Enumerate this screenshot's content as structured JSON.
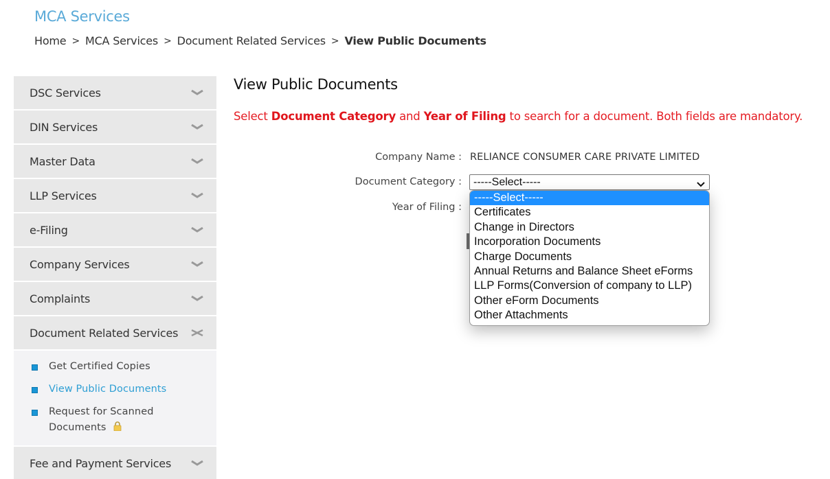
{
  "header": {
    "site_title": "MCA Services",
    "breadcrumb": [
      {
        "label": "Home"
      },
      {
        "label": "MCA Services"
      },
      {
        "label": "Document Related Services"
      },
      {
        "label": "View Public Documents"
      }
    ],
    "separator": ">"
  },
  "sidebar": {
    "items": [
      {
        "label": "DSC Services",
        "icon": "chevron-down-icon"
      },
      {
        "label": "DIN Services",
        "icon": "chevron-down-icon"
      },
      {
        "label": "Master Data",
        "icon": "chevron-down-icon"
      },
      {
        "label": "LLP Services",
        "icon": "chevron-down-icon"
      },
      {
        "label": "e-Filing",
        "icon": "chevron-down-icon"
      },
      {
        "label": "Company Services",
        "icon": "chevron-down-icon"
      },
      {
        "label": "Complaints",
        "icon": "chevron-down-icon"
      },
      {
        "label": "Document Related Services",
        "icon": "collapse-icon",
        "expanded": true
      },
      {
        "label": "Fee and Payment Services",
        "icon": "chevron-down-icon"
      }
    ],
    "sub_items": [
      {
        "label": "Get Certified Copies",
        "active": false
      },
      {
        "label": "View Public Documents",
        "active": true
      },
      {
        "label": "Request for Scanned Documents",
        "active": false,
        "locked": true,
        "icon": "lock-icon"
      }
    ]
  },
  "main": {
    "title": "View Public Documents",
    "instruction": {
      "part1": "Select ",
      "bold1": "Document Category",
      "part2": " and ",
      "bold2": "Year of Filing",
      "part3": " to search for a document. Both fields are mandatory."
    },
    "form": {
      "company_name_label": "Company Name :",
      "company_name_value": "RELIANCE CONSUMER CARE PRIVATE LIMITED",
      "document_category_label": "Document Category :",
      "document_category_value": "-----Select-----",
      "year_of_filing_label": "Year of Filing :"
    },
    "dropdown": {
      "options": [
        {
          "label": "-----Select-----",
          "selected": true
        },
        {
          "label": "Certificates"
        },
        {
          "label": "Change in Directors"
        },
        {
          "label": "Incorporation Documents"
        },
        {
          "label": "Charge Documents"
        },
        {
          "label": "Annual Returns and Balance Sheet eForms"
        },
        {
          "label": "LLP Forms(Conversion of company to LLP)"
        },
        {
          "label": "Other eForm Documents"
        },
        {
          "label": "Other Attachments"
        }
      ]
    }
  },
  "colors": {
    "brand_title": "#5aaad8",
    "instruction_red": "#e51c23",
    "active_link": "#2f9fd4",
    "bullet": "#1a96d6",
    "option_highlight": "#1e90ff",
    "sidebar_bg": "#e8e8e8"
  }
}
